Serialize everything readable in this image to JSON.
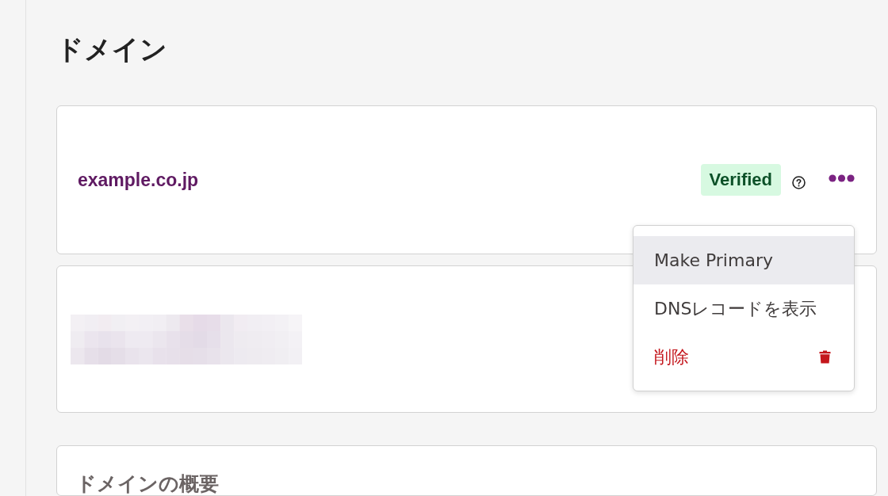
{
  "page": {
    "title": "ドメイン"
  },
  "domains": [
    {
      "kind": "domain",
      "name": "example.co.jp",
      "badge": "Verified"
    },
    {
      "kind": "redacted"
    }
  ],
  "menu": {
    "items": [
      {
        "label": "Make Primary",
        "kind": "normal",
        "highlighted": true
      },
      {
        "label": "DNSレコードを表示",
        "kind": "normal",
        "highlighted": false
      },
      {
        "label": "削除",
        "kind": "danger",
        "highlighted": false
      }
    ]
  },
  "overview": {
    "title": "ドメインの概要"
  }
}
